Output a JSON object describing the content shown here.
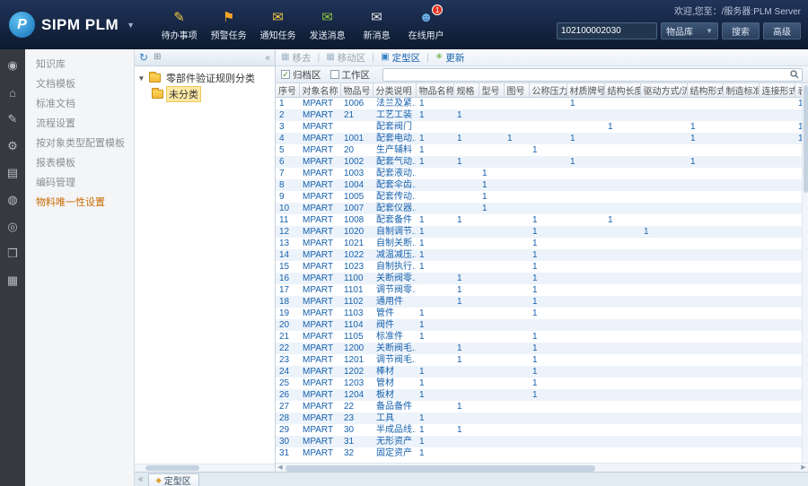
{
  "header": {
    "logo_text": "SIPM PLM",
    "welcome_text": "欢迎,您至：/服务器:PLM Server",
    "toolbar": [
      {
        "id": "todo-items",
        "label": "待办事项",
        "glyph": "✎",
        "color": "#f5c842"
      },
      {
        "id": "alert-tasks",
        "label": "预警任务",
        "glyph": "⚑",
        "color": "#f5a623"
      },
      {
        "id": "notify-tasks",
        "label": "通知任务",
        "glyph": "✉",
        "color": "#f5c842"
      },
      {
        "id": "send-message",
        "label": "发送消息",
        "glyph": "✉",
        "color": "#8dc63f"
      },
      {
        "id": "new-message",
        "label": "新消息",
        "glyph": "✉",
        "color": "#e8e8e8"
      },
      {
        "id": "online-users",
        "label": "在线用户",
        "glyph": "☻",
        "color": "#6ab0e8",
        "badge": "1"
      }
    ],
    "search": {
      "value": "102100002030",
      "scope": "物品库",
      "search_label": "搜索",
      "advanced_label": "高级"
    }
  },
  "rail": {
    "icons": [
      {
        "id": "media-icon",
        "glyph": "◉"
      },
      {
        "id": "home-icon",
        "glyph": "⌂"
      },
      {
        "id": "edit-icon",
        "glyph": "✎"
      },
      {
        "id": "settings-icon",
        "glyph": "⚙"
      },
      {
        "id": "database-icon",
        "glyph": "▤"
      },
      {
        "id": "video-icon",
        "glyph": "◍"
      },
      {
        "id": "target-icon",
        "glyph": "◎"
      },
      {
        "id": "book-icon",
        "glyph": "❒"
      },
      {
        "id": "card-icon",
        "glyph": "▦"
      }
    ]
  },
  "menu": {
    "items": [
      "知识库",
      "文档模板",
      "标准文档",
      "流程设置",
      "按对象类型配置模板",
      "报表模板",
      "编码管理",
      "物料唯一性设置"
    ],
    "active": "物料唯一性设置"
  },
  "tree": {
    "root": "零部件验证规则分类",
    "selected": "未分类"
  },
  "content": {
    "toolbar": {
      "remove": "移去",
      "move": "移动区",
      "fixed": "定型区",
      "refresh": "更新",
      "archive": "归档区",
      "work": "工作区"
    },
    "footer_tab": "定型区",
    "table": {
      "columns": [
        "序号",
        "对象名称",
        "物品号",
        "分类说明",
        "物品名称",
        "规格",
        "型号",
        "图号",
        "公称压力",
        "材质牌号",
        "结构长度",
        "驱动方式/流量…",
        "结构形式",
        "制造标准",
        "连接形式",
        "表…"
      ],
      "rows": [
        {
          "no": "1",
          "name": "MPART",
          "item_no": "1006",
          "desc": "法兰及紧..",
          "ones": [
            4,
            9,
            15
          ]
        },
        {
          "no": "2",
          "name": "MPART",
          "item_no": "21",
          "desc": "工艺工装",
          "ones": [
            4,
            5
          ]
        },
        {
          "no": "3",
          "name": "MPART",
          "item_no": "",
          "desc": "配套阀门",
          "ones": [
            10,
            12,
            15
          ]
        },
        {
          "no": "4",
          "name": "MPART",
          "item_no": "1001",
          "desc": "配套电动..",
          "ones": [
            4,
            5,
            7,
            9,
            12,
            15
          ]
        },
        {
          "no": "5",
          "name": "MPART",
          "item_no": "20",
          "desc": "生产辅料",
          "ones": [
            4,
            8
          ]
        },
        {
          "no": "6",
          "name": "MPART",
          "item_no": "1002",
          "desc": "配套气动..",
          "ones": [
            4,
            5,
            9,
            12
          ]
        },
        {
          "no": "7",
          "name": "MPART",
          "item_no": "1003",
          "desc": "配套液动..",
          "ones": [
            6
          ]
        },
        {
          "no": "8",
          "name": "MPART",
          "item_no": "1004",
          "desc": "配套伞齿..",
          "ones": [
            6
          ]
        },
        {
          "no": "9",
          "name": "MPART",
          "item_no": "1005",
          "desc": "配套传动..",
          "ones": [
            6
          ]
        },
        {
          "no": "10",
          "name": "MPART",
          "item_no": "1007",
          "desc": "配套仪器..",
          "ones": [
            6
          ]
        },
        {
          "no": "11",
          "name": "MPART",
          "item_no": "1008",
          "desc": "配套备件",
          "ones": [
            4,
            5,
            8,
            10
          ]
        },
        {
          "no": "12",
          "name": "MPART",
          "item_no": "1020",
          "desc": "自制调节..",
          "ones": [
            4,
            8,
            11
          ]
        },
        {
          "no": "13",
          "name": "MPART",
          "item_no": "1021",
          "desc": "自制关断..",
          "ones": [
            4,
            8
          ]
        },
        {
          "no": "14",
          "name": "MPART",
          "item_no": "1022",
          "desc": "减温减压..",
          "ones": [
            4,
            8
          ]
        },
        {
          "no": "15",
          "name": "MPART",
          "item_no": "1023",
          "desc": "自制执行..",
          "ones": [
            4,
            8
          ]
        },
        {
          "no": "16",
          "name": "MPART",
          "item_no": "1100",
          "desc": "关断阀零..",
          "ones": [
            5,
            8
          ]
        },
        {
          "no": "17",
          "name": "MPART",
          "item_no": "1101",
          "desc": "调节阀零..",
          "ones": [
            5,
            8
          ]
        },
        {
          "no": "18",
          "name": "MPART",
          "item_no": "1102",
          "desc": "通用件",
          "ones": [
            5,
            8
          ]
        },
        {
          "no": "19",
          "name": "MPART",
          "item_no": "1103",
          "desc": "管件",
          "ones": [
            4,
            8
          ]
        },
        {
          "no": "20",
          "name": "MPART",
          "item_no": "1104",
          "desc": "阀件",
          "ones": [
            4
          ]
        },
        {
          "no": "21",
          "name": "MPART",
          "item_no": "1105",
          "desc": "标准件",
          "ones": [
            4,
            8
          ]
        },
        {
          "no": "22",
          "name": "MPART",
          "item_no": "1200",
          "desc": "关断阀毛..",
          "ones": [
            5,
            8
          ]
        },
        {
          "no": "23",
          "name": "MPART",
          "item_no": "1201",
          "desc": "调节阀毛..",
          "ones": [
            5,
            8
          ]
        },
        {
          "no": "24",
          "name": "MPART",
          "item_no": "1202",
          "desc": "棒材",
          "ones": [
            4,
            8
          ]
        },
        {
          "no": "25",
          "name": "MPART",
          "item_no": "1203",
          "desc": "管材",
          "ones": [
            4,
            8
          ]
        },
        {
          "no": "26",
          "name": "MPART",
          "item_no": "1204",
          "desc": "板材",
          "ones": [
            4,
            8
          ]
        },
        {
          "no": "27",
          "name": "MPART",
          "item_no": "22",
          "desc": "备品备件",
          "ones": [
            5
          ]
        },
        {
          "no": "28",
          "name": "MPART",
          "item_no": "23",
          "desc": "工具",
          "ones": [
            4
          ]
        },
        {
          "no": "29",
          "name": "MPART",
          "item_no": "30",
          "desc": "半成品线..",
          "ones": [
            4,
            5
          ]
        },
        {
          "no": "30",
          "name": "MPART",
          "item_no": "31",
          "desc": "无形资产",
          "ones": [
            4
          ]
        },
        {
          "no": "31",
          "name": "MPART",
          "item_no": "32",
          "desc": "固定资产",
          "ones": [
            4
          ]
        }
      ]
    }
  }
}
